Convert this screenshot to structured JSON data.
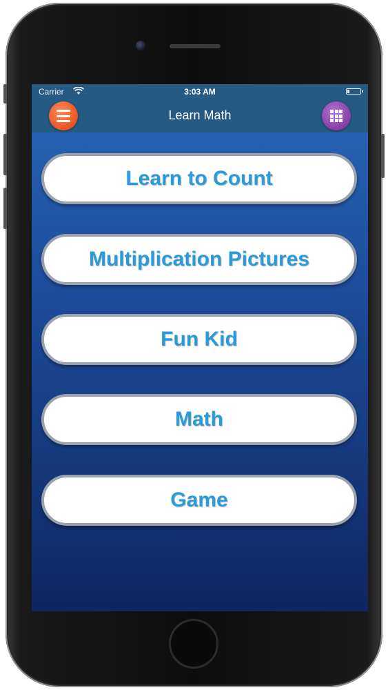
{
  "status_bar": {
    "carrier": "Carrier",
    "time": "3:03 AM"
  },
  "nav_bar": {
    "title": "Learn Math",
    "left_icon": "hamburger-menu-icon",
    "right_icon": "grid-apps-icon"
  },
  "menu": {
    "items": [
      {
        "label": "Learn to Count"
      },
      {
        "label": "Multiplication Pictures"
      },
      {
        "label": "Fun Kid"
      },
      {
        "label": "Math"
      },
      {
        "label": "Game"
      }
    ]
  },
  "colors": {
    "nav_bar": "#245a83",
    "menu_button": "#f05a28",
    "grid_button": "#8e44ad",
    "item_text": "#2a9ad8",
    "background_top": "#2a67b7",
    "background_bottom": "#0f2560"
  }
}
